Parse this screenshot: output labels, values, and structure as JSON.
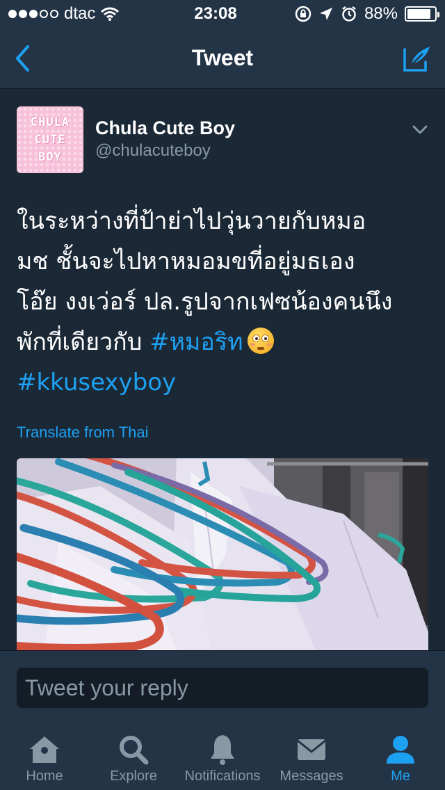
{
  "status_bar": {
    "carrier": "dtac",
    "time": "23:08",
    "battery_percent": "88%",
    "battery_level": 0.88,
    "signal_bars_filled": 3,
    "signal_bars_total": 5
  },
  "nav": {
    "title": "Tweet",
    "back_icon": "chevron-left-icon",
    "compose_icon": "compose-tweet-icon"
  },
  "tweet": {
    "avatar_text_lines": [
      "CHULA",
      "CUTE",
      "BOY"
    ],
    "author_name": "Chula Cute Boy",
    "author_handle": "@chulacuteboy",
    "text_lines": [
      "ในระหว่างที่ป้าย่าไปวุ่นวายกับหมอ",
      "มช ชั้นจะไปหาหมอมขที่อยู่มธเอง",
      "โอ๊ย งงเว่อร์ ปล.รูปจากเฟซน้องคนนึง",
      "พักที่เดียวกับ "
    ],
    "hashtag_1": "#หมอริท",
    "emoji": "flushed-face-emoji",
    "hashtag_2": "#kkusexyboy",
    "translate_label": "Translate from Thai",
    "photo": "hangers-and-white-shirts-photo"
  },
  "reply": {
    "placeholder": "Tweet your reply"
  },
  "tabs": [
    {
      "label": "Home",
      "icon": "home-icon",
      "active": false
    },
    {
      "label": "Explore",
      "icon": "search-icon",
      "active": false
    },
    {
      "label": "Notifications",
      "icon": "bell-icon",
      "active": false
    },
    {
      "label": "Messages",
      "icon": "envelope-icon",
      "active": false
    },
    {
      "label": "Me",
      "icon": "person-icon",
      "active": true
    }
  ],
  "colors": {
    "background": "#1b2836",
    "bar": "#243447",
    "accent": "#1da1f2",
    "secondary_text": "#8899a6"
  }
}
